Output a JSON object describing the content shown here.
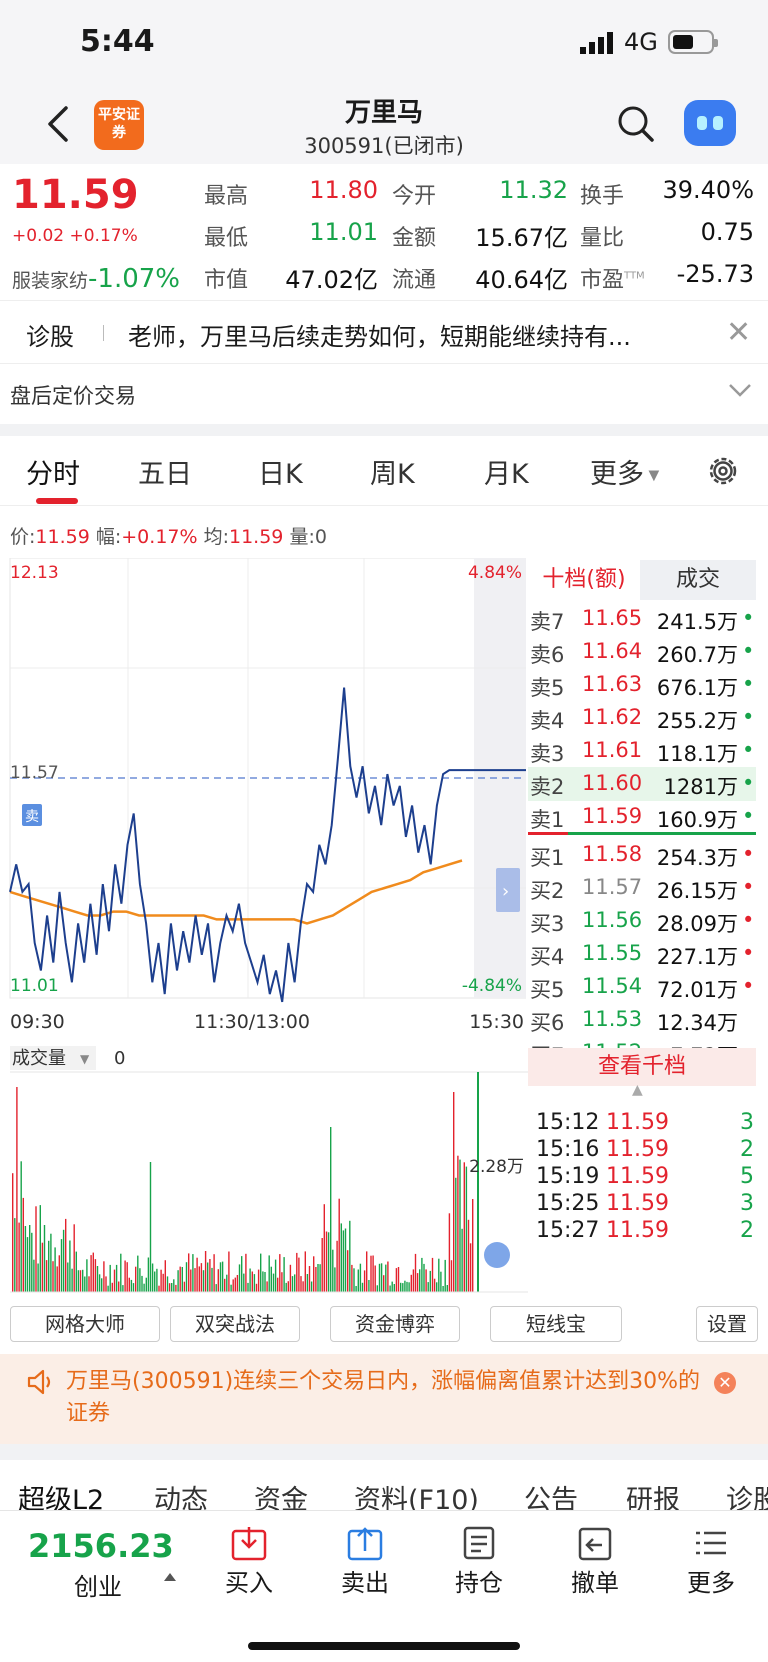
{
  "status": {
    "time": "5:44",
    "network": "4G"
  },
  "nav": {
    "logo_text": "平安证券",
    "title": "万里马",
    "subtitle": "300591(已闭市)"
  },
  "quote": {
    "price": "11.59",
    "change": "+0.02 +0.17%",
    "industry_name": "服装家纺",
    "industry_change": "-1.07%",
    "fields": [
      {
        "label": "最高",
        "value": "11.80",
        "color": "#e3222d"
      },
      {
        "label": "今开",
        "value": "11.32",
        "color": "#17a34a"
      },
      {
        "label": "换手",
        "value": "39.40%",
        "color": "#111111"
      },
      {
        "label": "最低",
        "value": "11.01",
        "color": "#17a34a"
      },
      {
        "label": "金额",
        "value": "15.67亿",
        "color": "#111111"
      },
      {
        "label": "量比",
        "value": "0.75",
        "color": "#111111"
      },
      {
        "label": "市值",
        "value": "47.02亿",
        "color": "#111111"
      },
      {
        "label": "流通",
        "value": "40.64亿",
        "color": "#111111"
      },
      {
        "label": "市盈",
        "value": "-25.73",
        "color": "#111111"
      }
    ],
    "pe_sup": "TTM"
  },
  "tips": {
    "tag": "诊股",
    "text": "老师，万里马后续走势如何，短期能继续持有..."
  },
  "after_hours": {
    "label": "盘后定价交易"
  },
  "tabs": [
    "分时",
    "五日",
    "日K",
    "周K",
    "月K",
    "更多"
  ],
  "info": {
    "price_label": "价:",
    "price": "11.59",
    "amp_label": "幅:",
    "amp": "+0.17%",
    "avg_label": "均:",
    "avg": "11.59",
    "vol_label": "量:",
    "vol": "0"
  },
  "chart_data": {
    "type": "line",
    "y_top": "12.13",
    "y_mid": "11.57",
    "y_bottom": "11.01",
    "pct_top": "4.84%",
    "pct_bottom": "-4.84%",
    "x_labels": [
      "09:30",
      "11:30/13:00",
      "15:30"
    ],
    "ylim": [
      11.01,
      12.13
    ],
    "prev_close": 11.57,
    "sell_marker": "卖",
    "series": [
      {
        "values": [
          11.28,
          11.35,
          11.28,
          11.3,
          11.15,
          11.08,
          11.22,
          11.1,
          11.28,
          11.15,
          11.05,
          11.2,
          11.1,
          11.25,
          11.12,
          11.3,
          11.18,
          11.35,
          11.25,
          11.4,
          11.48,
          11.3,
          11.2,
          11.05,
          11.15,
          11.02,
          11.2,
          11.08,
          11.18,
          11.1,
          11.22,
          11.12,
          11.2,
          11.05,
          11.15,
          11.22,
          11.18,
          11.25,
          11.15,
          11.1,
          11.05,
          11.12,
          11.02,
          11.08,
          11.0,
          11.15,
          11.05,
          11.2,
          11.3,
          11.28,
          11.4,
          11.35,
          11.45,
          11.62,
          11.8,
          11.6,
          11.52,
          11.6,
          11.48,
          11.55,
          11.45,
          11.58,
          11.5,
          11.55,
          11.42,
          11.5,
          11.38,
          11.45,
          11.35,
          11.5,
          11.58,
          11.59,
          11.59,
          11.59,
          11.59,
          11.59
        ]
      },
      {
        "values": [
          11.28,
          11.27,
          11.26,
          11.25,
          11.24,
          11.23,
          11.22,
          11.22,
          11.23,
          11.23,
          11.22,
          11.22,
          11.22,
          11.22,
          11.22,
          11.22,
          11.21,
          11.21,
          11.21,
          11.21,
          11.21,
          11.21,
          11.21,
          11.2,
          11.21,
          11.22,
          11.24,
          11.26,
          11.28,
          11.29,
          11.3,
          11.31,
          11.33,
          11.34,
          11.35,
          11.36
        ]
      }
    ]
  },
  "orderbook": {
    "tab_active": "十档(额)",
    "tab_other": "成交",
    "asks": [
      {
        "label": "卖7",
        "price": "11.65",
        "amount": "241.5万"
      },
      {
        "label": "卖6",
        "price": "11.64",
        "amount": "260.7万"
      },
      {
        "label": "卖5",
        "price": "11.63",
        "amount": "676.1万"
      },
      {
        "label": "卖4",
        "price": "11.62",
        "amount": "255.2万"
      },
      {
        "label": "卖3",
        "price": "11.61",
        "amount": "118.1万"
      },
      {
        "label": "卖2",
        "price": "11.60",
        "amount": "1281万"
      },
      {
        "label": "卖1",
        "price": "11.59",
        "amount": "160.9万"
      }
    ],
    "bids": [
      {
        "label": "买1",
        "price": "11.58",
        "amount": "254.3万",
        "color": "#e3222d"
      },
      {
        "label": "买2",
        "price": "11.57",
        "amount": "26.15万",
        "color": "#888888"
      },
      {
        "label": "买3",
        "price": "11.56",
        "amount": "28.09万",
        "color": "#17a34a"
      },
      {
        "label": "买4",
        "price": "11.55",
        "amount": "227.1万",
        "color": "#17a34a"
      },
      {
        "label": "买5",
        "price": "11.54",
        "amount": "72.01万",
        "color": "#17a34a"
      },
      {
        "label": "买6",
        "price": "11.53",
        "amount": "12.34万",
        "color": "#17a34a"
      },
      {
        "label": "买7",
        "price": "11.52",
        "amount": "7.72万",
        "color": "#17a34a"
      }
    ],
    "view_more": "查看千档"
  },
  "volume": {
    "label": "成交量",
    "value": "0",
    "max_label": "2.28万"
  },
  "trades": [
    {
      "time": "15:12",
      "price": "11.59",
      "qty": "3"
    },
    {
      "time": "15:16",
      "price": "11.59",
      "qty": "2"
    },
    {
      "time": "15:19",
      "price": "11.59",
      "qty": "5"
    },
    {
      "time": "15:25",
      "price": "11.59",
      "qty": "3"
    },
    {
      "time": "15:27",
      "price": "11.59",
      "qty": "2"
    }
  ],
  "tools": [
    "网格大师",
    "双突战法",
    "资金博弈",
    "短线宝",
    "设置"
  ],
  "notice": {
    "text": "万里马(300591)连续三个交易日内，涨幅偏离值累计达到30%的证券"
  },
  "subtabs": [
    "超级L2",
    "动态",
    "资金",
    "资料(F10)",
    "公告",
    "研报",
    "诊股"
  ],
  "bottom": {
    "index_value": "2156.23",
    "index_name": "创业",
    "buttons": [
      "买入",
      "卖出",
      "持仓",
      "撤单",
      "更多"
    ]
  }
}
